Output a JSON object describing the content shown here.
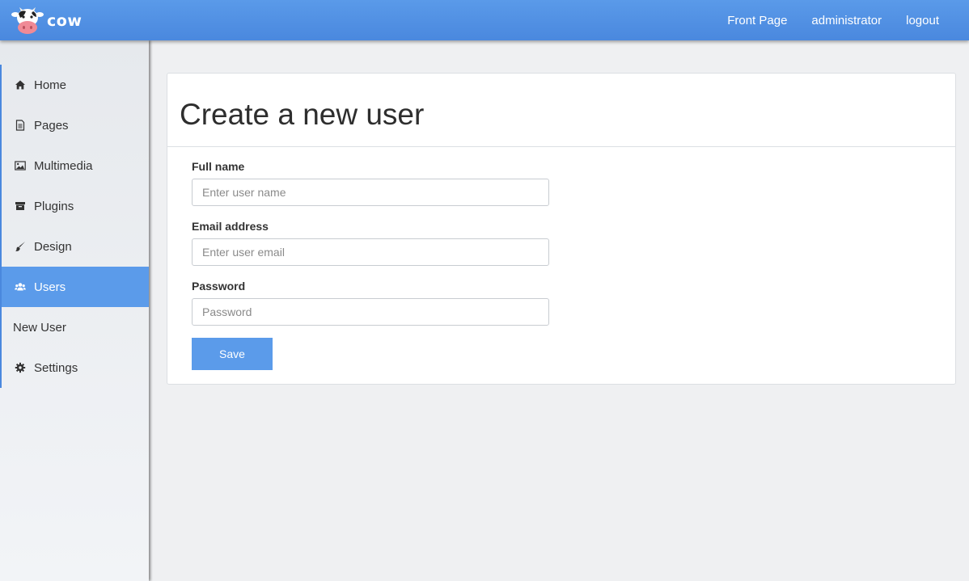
{
  "header": {
    "brand": "cow",
    "nav": [
      "Front Page",
      "administrator",
      "logout"
    ]
  },
  "sidebar": {
    "items": [
      {
        "label": "Home",
        "icon": "home-icon"
      },
      {
        "label": "Pages",
        "icon": "document-icon"
      },
      {
        "label": "Multimedia",
        "icon": "image-icon"
      },
      {
        "label": "Plugins",
        "icon": "archive-icon"
      },
      {
        "label": "Design",
        "icon": "brush-icon"
      },
      {
        "label": "Users",
        "icon": "users-icon",
        "active": true
      },
      {
        "label": "New User"
      },
      {
        "label": "Settings",
        "icon": "gear-icon"
      }
    ]
  },
  "main": {
    "title": "Create a new user",
    "form": {
      "fullname": {
        "label": "Full name",
        "placeholder": "Enter user name",
        "value": ""
      },
      "email": {
        "label": "Email address",
        "placeholder": "Enter user email",
        "value": ""
      },
      "password": {
        "label": "Password",
        "placeholder": "Password",
        "value": ""
      },
      "save_label": "Save"
    }
  },
  "colors": {
    "accent": "#5b9bea",
    "header": "#4a88de",
    "background": "#eff0f2"
  }
}
